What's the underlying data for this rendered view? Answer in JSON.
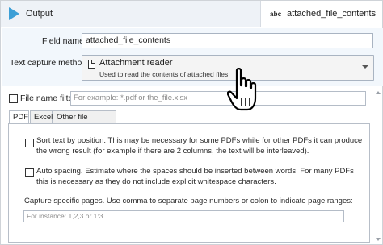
{
  "header": {
    "output_label": "Output",
    "node_type_icon": "abc",
    "node_name": "attached_file_contents"
  },
  "form": {
    "field_name_label": "Field name",
    "field_name_value": "attached_file_contents",
    "capture_method_label": "Text capture method",
    "capture_method_title": "Attachment reader",
    "capture_method_desc": "Used to read the contents of attached files"
  },
  "filter": {
    "label": "File name filter",
    "placeholder": "For example: *.pdf or the_file.xlsx"
  },
  "tabs": [
    {
      "label": "PDF",
      "active": true
    },
    {
      "label": "Excel",
      "active": false
    },
    {
      "label": "Other file formats",
      "active": false
    }
  ],
  "pdf_options": {
    "sort_text": "Sort text by position. This may be necessary for some PDFs while for other PDFs it can produce the wrong result (for example if there are 2 columns, the text will be interleaved).",
    "auto_spacing": "Auto spacing. Estimate where the spaces should be inserted between words. For many PDFs this is necessary as they do not include explicit whitespace characters.",
    "pages_label": "Capture specific pages. Use comma to separate page numbers or colon to indicate page ranges:",
    "pages_placeholder": "For instance: 1,2,3 or 1:3"
  },
  "colors": {
    "accent": "#3d9fd6",
    "header_bg": "#eef2f7",
    "form_bg": "#f2f7fc"
  }
}
